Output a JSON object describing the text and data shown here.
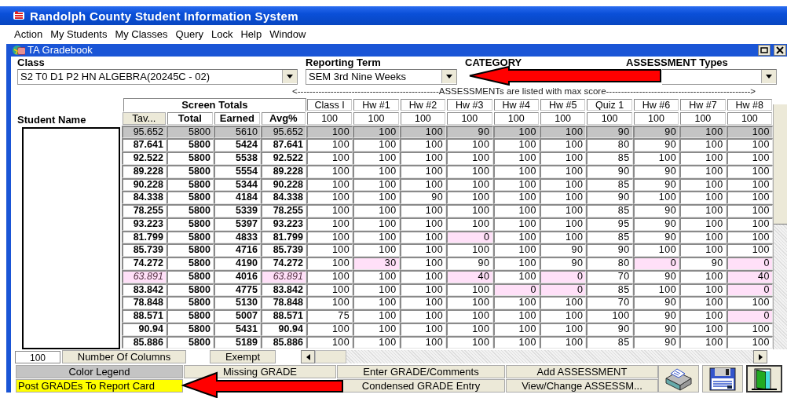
{
  "window": {
    "title": "Randolph County Student Information System"
  },
  "menu": [
    "Action",
    "My Students",
    "My Classes",
    "Query",
    "Lock",
    "Help",
    "Window"
  ],
  "gradebook": {
    "title": "TA Gradebook",
    "filters": [
      {
        "label": "Class",
        "value": "S2 T0 D1 P2 HN ALGEBRA(20245C - 02)",
        "kind": "dropdown"
      },
      {
        "label": "Reporting Term",
        "value": "SEM 3rd Nine Weeks",
        "kind": "dropdown"
      },
      {
        "label": "CATEGORY",
        "kind": "covered"
      },
      {
        "label": "ASSESSMENT Types",
        "kind": "partly_covered"
      }
    ],
    "note": "<-----------------------------------------------ASSESSMENTs are listed with max score------------------------------------------------>",
    "table": {
      "name_header": "Student Name",
      "group_header": "Screen Totals",
      "totals_columns": [
        {
          "label": "Tav...",
          "kind": "button"
        },
        {
          "label": "Total",
          "kind": "header"
        },
        {
          "label": "Earned",
          "kind": "header"
        },
        {
          "label": "Avg%",
          "kind": "header"
        }
      ],
      "assessments": [
        {
          "name": "Class I",
          "max": "100"
        },
        {
          "name": "Hw #1",
          "max": "100"
        },
        {
          "name": "Hw #2",
          "max": "100"
        },
        {
          "name": "Hw #3",
          "max": "100"
        },
        {
          "name": "Hw #4",
          "max": "100"
        },
        {
          "name": "Hw #5",
          "max": "100"
        },
        {
          "name": "Quiz 1",
          "max": "100"
        },
        {
          "name": "Hw #6",
          "max": "100"
        },
        {
          "name": "Hw #7",
          "max": "100"
        },
        {
          "name": "Hw #8",
          "max": "100"
        }
      ],
      "rows": [
        {
          "selected": true,
          "tav": "95.652",
          "total": "5800",
          "earned": "5610",
          "avg": "95.652",
          "low_avg": false,
          "scores": [
            "100",
            "100",
            "100",
            "90",
            "100",
            "100",
            "90",
            "90",
            "100",
            "100"
          ],
          "low": [
            false,
            false,
            false,
            false,
            false,
            false,
            false,
            false,
            false,
            false
          ]
        },
        {
          "selected": false,
          "tav": "87.641",
          "total": "5800",
          "earned": "5424",
          "avg": "87.641",
          "low_avg": false,
          "scores": [
            "100",
            "100",
            "100",
            "100",
            "100",
            "100",
            "80",
            "90",
            "100",
            "100"
          ],
          "low": [
            false,
            false,
            false,
            false,
            false,
            false,
            false,
            false,
            false,
            false
          ]
        },
        {
          "selected": false,
          "tav": "92.522",
          "total": "5800",
          "earned": "5538",
          "avg": "92.522",
          "low_avg": false,
          "scores": [
            "100",
            "100",
            "100",
            "100",
            "100",
            "100",
            "85",
            "100",
            "100",
            "100"
          ],
          "low": [
            false,
            false,
            false,
            false,
            false,
            false,
            false,
            false,
            false,
            false
          ]
        },
        {
          "selected": false,
          "tav": "89.228",
          "total": "5800",
          "earned": "5554",
          "avg": "89.228",
          "low_avg": false,
          "scores": [
            "100",
            "100",
            "100",
            "100",
            "100",
            "100",
            "90",
            "90",
            "100",
            "100"
          ],
          "low": [
            false,
            false,
            false,
            false,
            false,
            false,
            false,
            false,
            false,
            false
          ]
        },
        {
          "selected": false,
          "tav": "90.228",
          "total": "5800",
          "earned": "5344",
          "avg": "90.228",
          "low_avg": false,
          "scores": [
            "100",
            "100",
            "100",
            "100",
            "100",
            "100",
            "85",
            "90",
            "100",
            "100"
          ],
          "low": [
            false,
            false,
            false,
            false,
            false,
            false,
            false,
            false,
            false,
            false
          ]
        },
        {
          "selected": false,
          "tav": "84.338",
          "total": "5800",
          "earned": "4184",
          "avg": "84.338",
          "low_avg": false,
          "scores": [
            "100",
            "100",
            "90",
            "100",
            "100",
            "100",
            "90",
            "100",
            "100",
            "100"
          ],
          "low": [
            false,
            false,
            false,
            false,
            false,
            false,
            false,
            false,
            false,
            false
          ]
        },
        {
          "selected": false,
          "tav": "78.255",
          "total": "5800",
          "earned": "5339",
          "avg": "78.255",
          "low_avg": false,
          "scores": [
            "100",
            "100",
            "100",
            "100",
            "100",
            "100",
            "85",
            "90",
            "100",
            "100"
          ],
          "low": [
            false,
            false,
            false,
            false,
            false,
            false,
            false,
            false,
            false,
            false
          ]
        },
        {
          "selected": false,
          "tav": "93.223",
          "total": "5800",
          "earned": "5397",
          "avg": "93.223",
          "low_avg": false,
          "scores": [
            "100",
            "100",
            "100",
            "100",
            "100",
            "100",
            "95",
            "90",
            "100",
            "100"
          ],
          "low": [
            false,
            false,
            false,
            false,
            false,
            false,
            false,
            false,
            false,
            false
          ]
        },
        {
          "selected": false,
          "tav": "81.799",
          "total": "5800",
          "earned": "4833",
          "avg": "81.799",
          "low_avg": false,
          "scores": [
            "100",
            "100",
            "100",
            "0",
            "100",
            "100",
            "85",
            "90",
            "100",
            "100"
          ],
          "low": [
            false,
            false,
            false,
            true,
            false,
            false,
            false,
            false,
            false,
            false
          ]
        },
        {
          "selected": false,
          "tav": "85.739",
          "total": "5800",
          "earned": "4716",
          "avg": "85.739",
          "low_avg": false,
          "scores": [
            "100",
            "100",
            "100",
            "100",
            "100",
            "90",
            "90",
            "100",
            "100",
            "100"
          ],
          "low": [
            false,
            false,
            false,
            false,
            false,
            false,
            false,
            false,
            false,
            false
          ]
        },
        {
          "selected": false,
          "tav": "74.272",
          "total": "5800",
          "earned": "4190",
          "avg": "74.272",
          "low_avg": false,
          "scores": [
            "100",
            "30",
            "100",
            "90",
            "100",
            "90",
            "80",
            "0",
            "90",
            "0"
          ],
          "low": [
            false,
            true,
            false,
            false,
            false,
            false,
            false,
            true,
            false,
            true
          ]
        },
        {
          "selected": false,
          "tav": "63.891",
          "total": "5800",
          "earned": "4016",
          "avg": "63.891",
          "low_avg": true,
          "scores": [
            "100",
            "100",
            "100",
            "40",
            "100",
            "0",
            "70",
            "90",
            "100",
            "40"
          ],
          "low": [
            false,
            false,
            false,
            true,
            false,
            true,
            false,
            false,
            false,
            true
          ]
        },
        {
          "selected": false,
          "tav": "83.842",
          "total": "5800",
          "earned": "4775",
          "avg": "83.842",
          "low_avg": false,
          "scores": [
            "100",
            "100",
            "100",
            "100",
            "0",
            "0",
            "85",
            "100",
            "100",
            "0"
          ],
          "low": [
            false,
            false,
            false,
            false,
            true,
            true,
            false,
            false,
            false,
            true
          ]
        },
        {
          "selected": false,
          "tav": "78.848",
          "total": "5800",
          "earned": "5130",
          "avg": "78.848",
          "low_avg": false,
          "scores": [
            "100",
            "100",
            "100",
            "100",
            "100",
            "100",
            "70",
            "90",
            "100",
            "100"
          ],
          "low": [
            false,
            false,
            false,
            false,
            false,
            false,
            false,
            false,
            false,
            false
          ]
        },
        {
          "selected": false,
          "tav": "88.571",
          "total": "5800",
          "earned": "5007",
          "avg": "88.571",
          "low_avg": false,
          "scores": [
            "75",
            "100",
            "100",
            "100",
            "100",
            "100",
            "100",
            "90",
            "100",
            "0"
          ],
          "low": [
            false,
            false,
            false,
            false,
            false,
            false,
            false,
            false,
            false,
            true
          ]
        },
        {
          "selected": false,
          "tav": "90.94",
          "total": "5800",
          "earned": "5431",
          "avg": "90.94",
          "low_avg": false,
          "scores": [
            "100",
            "100",
            "100",
            "100",
            "100",
            "100",
            "90",
            "90",
            "100",
            "100"
          ],
          "low": [
            false,
            false,
            false,
            false,
            false,
            false,
            false,
            false,
            false,
            false
          ]
        },
        {
          "selected": false,
          "tav": "85.886",
          "total": "5800",
          "earned": "5189",
          "avg": "85.886",
          "low_avg": false,
          "scores": [
            "100",
            "100",
            "100",
            "100",
            "100",
            "100",
            "85",
            "90",
            "100",
            "100"
          ],
          "low": [
            false,
            false,
            false,
            false,
            false,
            false,
            false,
            false,
            false,
            false
          ]
        }
      ]
    },
    "columns_field": {
      "value": "100",
      "button": "Number Of Columns"
    },
    "exempt_button": "Exempt",
    "buttons": [
      {
        "label": "Color Legend",
        "kind": "legend"
      },
      {
        "label": "Missing GRADE",
        "kind": "plain"
      },
      {
        "label": "Enter GRADE/Comments",
        "kind": "plain"
      },
      {
        "label": "Add ASSESSMENT",
        "kind": "plain"
      },
      {
        "label": "Post GRADEs To Report Card",
        "kind": "highlight"
      },
      {
        "kind": "covered"
      },
      {
        "label": "Condensed GRADE Entry",
        "kind": "plain"
      },
      {
        "label": "View/Change ASSESSM...",
        "kind": "plain"
      }
    ]
  }
}
